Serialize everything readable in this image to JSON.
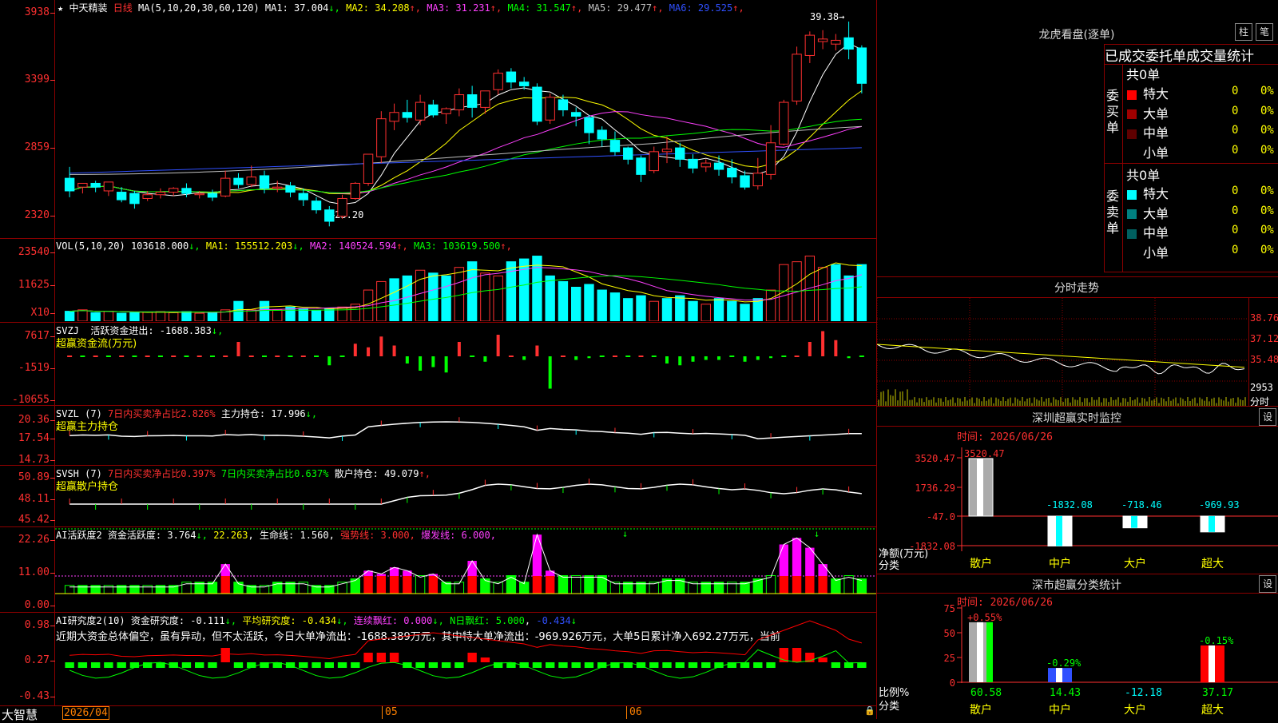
{
  "chart": {
    "stock_name": "中天精装",
    "period": "日线",
    "ma_label": "MA(5,10,20,30,60,120)",
    "ma_values": [
      {
        "label": "MA1: 37.004",
        "arrow": "↓",
        "color": "#ffffff"
      },
      {
        "label": "MA2: 34.208",
        "arrow": "↑",
        "color": "#ffff00"
      },
      {
        "label": "MA3: 31.231",
        "arrow": "↑",
        "color": "#ff40ff"
      },
      {
        "label": "MA4: 31.547",
        "arrow": "↑",
        "color": "#00ff00"
      },
      {
        "label": "MA5: 29.477",
        "arrow": "↑",
        "color": "#c0c0c0"
      },
      {
        "label": "MA6: 29.525",
        "arrow": "↑",
        "color": "#3050ff"
      }
    ],
    "price_axis": [
      "3938",
      "3399",
      "2859",
      "2320"
    ],
    "high_label": "39.38",
    "low_label": "23.20",
    "candles": [
      [
        27,
        27.9,
        26,
        25.5
      ],
      [
        26.3,
        26.5,
        26.6,
        25.8
      ],
      [
        26.6,
        26.8,
        26.3,
        25.9
      ],
      [
        26,
        26.6,
        26.7,
        25.6
      ],
      [
        25.9,
        26.3,
        25.3,
        25.1
      ],
      [
        25.8,
        26,
        25,
        24.6
      ],
      [
        25.4,
        26,
        25.7,
        25.2
      ],
      [
        25.7,
        26.2,
        25.9,
        25.4
      ],
      [
        25.9,
        26.3,
        26.2,
        25.6
      ],
      [
        26.2,
        26.6,
        25.8,
        25.5
      ],
      [
        25.7,
        26,
        25.8,
        25.4
      ],
      [
        25.8,
        26.1,
        25.5,
        25.2
      ],
      [
        25.6,
        27.6,
        27,
        25.5
      ],
      [
        27,
        27.4,
        26.5,
        26.2
      ],
      [
        26.5,
        28,
        27.1,
        26.3
      ],
      [
        27.2,
        27.6,
        26.2,
        25.8
      ],
      [
        26.2,
        26.8,
        26.3,
        25.9
      ],
      [
        26.4,
        26.7,
        25.9,
        25.5
      ],
      [
        25.8,
        26.2,
        25.3,
        24.8
      ],
      [
        25.2,
        25.5,
        24.5,
        24.2
      ],
      [
        24.5,
        24.8,
        23.6,
        23.2
      ],
      [
        24,
        25.7,
        25.4,
        23.8
      ],
      [
        25.4,
        26.7,
        26.6,
        25.3
      ],
      [
        26.6,
        28.7,
        28.9,
        26.4
      ],
      [
        28.7,
        32.3,
        31.7,
        28.2
      ],
      [
        31.5,
        32.9,
        32.2,
        30.8
      ],
      [
        32.2,
        33.2,
        31.8,
        31.4
      ],
      [
        31.6,
        33.6,
        33,
        31.2
      ],
      [
        32.8,
        33.2,
        32,
        31.8
      ],
      [
        32.1,
        32.6,
        32.5,
        31.3
      ],
      [
        32.4,
        34.1,
        33.6,
        31.9
      ],
      [
        33.6,
        34.3,
        32.6,
        31.8
      ],
      [
        32.6,
        33.7,
        33.9,
        32.1
      ],
      [
        34,
        35.6,
        35.3,
        33.6
      ],
      [
        35.4,
        35.7,
        34.6,
        34.1
      ],
      [
        34.6,
        35,
        34.3,
        34
      ],
      [
        34.2,
        34.5,
        31.5,
        31.2
      ],
      [
        31.6,
        33.7,
        33.4,
        31.3
      ],
      [
        33.2,
        33.6,
        32.4,
        31.9
      ],
      [
        32.2,
        32.6,
        31.9,
        31.1
      ],
      [
        31.8,
        32,
        30.6,
        29.7
      ],
      [
        30.8,
        31.1,
        30.1,
        29.5
      ],
      [
        30,
        30.7,
        29.1,
        28.8
      ],
      [
        29.4,
        29.5,
        28.5,
        28.1
      ],
      [
        28.6,
        28.8,
        27.3,
        26.7
      ],
      [
        27.6,
        29.5,
        29.1,
        27.4
      ],
      [
        29.1,
        30.3,
        29.3,
        28.2
      ],
      [
        29.4,
        29.8,
        28.5,
        27.9
      ],
      [
        28.5,
        28.9,
        27.8,
        27.4
      ],
      [
        27.9,
        28.5,
        28.2,
        27.5
      ],
      [
        28.2,
        28.8,
        27.7,
        27.2
      ],
      [
        27.8,
        28.5,
        27.1,
        26.6
      ],
      [
        27.2,
        27.6,
        26.3,
        26.1
      ],
      [
        26.4,
        28.6,
        27.4,
        26.1
      ],
      [
        27.3,
        31.2,
        29.8,
        26.9
      ],
      [
        29.7,
        33.2,
        33,
        29.6
      ],
      [
        33.1,
        37.4,
        36.8,
        32.8
      ],
      [
        36.7,
        38.6,
        38.3,
        36.1
      ],
      [
        37.8,
        38.7,
        38,
        37.2
      ],
      [
        37.6,
        38.4,
        37.9,
        37.1
      ],
      [
        38.1,
        39.38,
        37.2,
        36.4
      ],
      [
        37.3,
        37.5,
        34.5,
        33.7
      ]
    ],
    "vol_label": "VOL(5,10,20)",
    "vol_value": "103618.000",
    "vol_ma": [
      {
        "label": "MA1: 155512.203",
        "arrow": "↓",
        "color": "#ffff00"
      },
      {
        "label": "MA2: 140524.594",
        "arrow": "↑",
        "color": "#ff40ff"
      },
      {
        "label": "MA3: 103619.500",
        "arrow": "↑",
        "color": "#00ff00"
      }
    ],
    "vol_axis": [
      "23540",
      "11625",
      "X10"
    ],
    "volumes": [
      [
        35,
        0
      ],
      [
        40,
        0
      ],
      [
        30,
        1
      ],
      [
        35,
        0
      ],
      [
        28,
        0
      ],
      [
        30,
        1
      ],
      [
        32,
        0
      ],
      [
        34,
        0
      ],
      [
        30,
        0
      ],
      [
        34,
        0
      ],
      [
        28,
        0
      ],
      [
        30,
        0
      ],
      [
        40,
        0
      ],
      [
        70,
        1
      ],
      [
        40,
        0
      ],
      [
        70,
        0
      ],
      [
        40,
        0
      ],
      [
        50,
        0
      ],
      [
        45,
        0
      ],
      [
        38,
        0
      ],
      [
        45,
        1
      ],
      [
        50,
        0
      ],
      [
        60,
        0
      ],
      [
        110,
        0
      ],
      [
        140,
        0
      ],
      [
        150,
        1
      ],
      [
        160,
        0
      ],
      [
        180,
        0
      ],
      [
        170,
        0
      ],
      [
        160,
        1
      ],
      [
        190,
        0
      ],
      [
        210,
        1
      ],
      [
        170,
        0
      ],
      [
        160,
        0
      ],
      [
        210,
        0
      ],
      [
        220,
        0
      ],
      [
        230,
        0
      ],
      [
        160,
        1
      ],
      [
        140,
        0
      ],
      [
        120,
        1
      ],
      [
        130,
        1
      ],
      [
        110,
        1
      ],
      [
        100,
        1
      ],
      [
        80,
        1
      ],
      [
        90,
        1
      ],
      [
        70,
        0
      ],
      [
        80,
        1
      ],
      [
        90,
        1
      ],
      [
        70,
        1
      ],
      [
        60,
        0
      ],
      [
        80,
        1
      ],
      [
        70,
        1
      ],
      [
        60,
        1
      ],
      [
        80,
        1
      ],
      [
        110,
        0
      ],
      [
        200,
        0
      ],
      [
        210,
        0
      ],
      [
        230,
        0
      ],
      [
        190,
        0
      ],
      [
        200,
        1
      ],
      [
        160,
        1
      ],
      [
        200,
        1
      ],
      [
        150,
        1
      ]
    ],
    "svzj": {
      "label1": "SVZJ",
      "label2": "活跃资金进出: -1688.383",
      "label2_arrow": "↓,",
      "title": "超赢资金流(万元)",
      "axis": [
        "7617",
        "-1519",
        "-10655"
      ],
      "bars": [
        0,
        0,
        0,
        0,
        0,
        0,
        0,
        0,
        0,
        0,
        0,
        0,
        0,
        40,
        0,
        0,
        0,
        0,
        0,
        0,
        -25,
        0,
        35,
        25,
        55,
        30,
        -20,
        -40,
        -30,
        -45,
        40,
        0,
        -15,
        60,
        0,
        -10,
        30,
        -90,
        0,
        -10,
        -5,
        0,
        0,
        0,
        0,
        0,
        -20,
        -25,
        -15,
        -10,
        -10,
        0,
        -15,
        -10,
        -5,
        0,
        0,
        40,
        70,
        45,
        -5,
        0,
        0,
        0
      ]
    },
    "svzl": {
      "label1": "SVZL  (7)",
      "label2": "7日内买卖净占比2.826%",
      "label3": "主力持仓: 17.996",
      "label3_arrow": "↓,",
      "title": "超赢主力持仓",
      "axis": [
        "20.36",
        "17.54",
        "14.73"
      ]
    },
    "svsh": {
      "label1": "SVSH  (7)",
      "label2": "7日内买卖净占比0.397%",
      "label3": "7日内买卖净占比0.637%",
      "label4": "散户持仓: 49.079",
      "label4_arrow": "↑,",
      "title": "超赢散户持仓",
      "axis": [
        "50.89",
        "48.11",
        "45.42"
      ]
    },
    "ai_active": {
      "label1": "AI活跃度2",
      "label2": "资金活跃度: 3.764",
      "label3": "22.263",
      "label4": "生命线: 1.560",
      "label5": "强势线: 3.000",
      "label6": "爆发线: 6.000",
      "axis": [
        "22.26",
        "11.00",
        "0.00"
      ]
    },
    "ai_research": {
      "label1": "AI研究度2(10)",
      "label2": "资金研究度: -0.111",
      "label3": "平均研究度: -0.434",
      "label4": "连续飘红: 0.000",
      "label5": "N日飘红: 5.000",
      "label6": "-0.434",
      "axis": [
        "0.98",
        "0.27",
        "-0.43"
      ],
      "commentary": "近期大资金总体偏空，虽有异动，但不太活跃，今日大单净流出：-1688.389万元，其中特大单净流出：-969.926万元，大单5日累计净入692.27万元，当前"
    },
    "date_axis": [
      "2026/04",
      "05",
      "06"
    ],
    "brand": "大智慧"
  },
  "right": {
    "longhu": {
      "title": "龙虎看盘(逐单)",
      "btn1": "柱",
      "btn2": "笔",
      "subtitle": "已成交委托单成交量统计",
      "buy_side": "委买单",
      "sell_side": "委卖单",
      "buy_total": "共0单",
      "sell_total": "共0单",
      "buy_rows": [
        {
          "label": "特大",
          "count": "0",
          "pct": "0%",
          "color": "#ff0000"
        },
        {
          "label": "大单",
          "count": "0",
          "pct": "0%",
          "color": "#a00000"
        },
        {
          "label": "中单",
          "count": "0",
          "pct": "0%",
          "color": "#600000"
        },
        {
          "label": "小单",
          "count": "0",
          "pct": "0%",
          "color": "#000000"
        }
      ],
      "sell_rows": [
        {
          "label": "特大",
          "count": "0",
          "pct": "0%",
          "color": "#00ffff"
        },
        {
          "label": "大单",
          "count": "0",
          "pct": "0%",
          "color": "#008080"
        },
        {
          "label": "中单",
          "count": "0",
          "pct": "0%",
          "color": "#006060"
        },
        {
          "label": "小单",
          "count": "0",
          "pct": "0%",
          "color": "#000000"
        }
      ]
    },
    "intraday": {
      "title": "分时走势",
      "axis": [
        "38.76",
        "37.12",
        "35.48",
        "2953"
      ],
      "unit": "分时"
    },
    "sz_monitor": {
      "title": "深圳超赢实时监控",
      "btn": "设",
      "time_label": "时间: 2026/06/26",
      "axis": [
        "3520.47",
        "1736.29",
        "-47.0",
        "-1832.08"
      ],
      "ylabel1": "净额(万元)",
      "ylabel2": "分类",
      "categories": [
        "散户",
        "中户",
        "大户",
        "超大"
      ],
      "values": [
        3520.47,
        -1832.08,
        -718.46,
        -969.93
      ],
      "value_labels": [
        "3520.47",
        "-1832.08",
        "-718.46",
        "-969.93"
      ]
    },
    "sz_class": {
      "title": "深市超赢分类统计",
      "btn": "设",
      "time_label": "时间: 2026/06/26",
      "axis": [
        "75",
        "50",
        "25",
        "0"
      ],
      "ylabel1": "比例%",
      "ylabel2": "分类",
      "categories": [
        "散户",
        "中户",
        "大户",
        "超大"
      ],
      "pct_labels": [
        "+0.55%",
        "-0.29%",
        "",
        "-0.15%"
      ],
      "values": [
        60.58,
        14.43,
        -12.18,
        37.17
      ],
      "value_labels": [
        "60.58",
        "14.43",
        "-12.18",
        "37.17"
      ]
    }
  }
}
